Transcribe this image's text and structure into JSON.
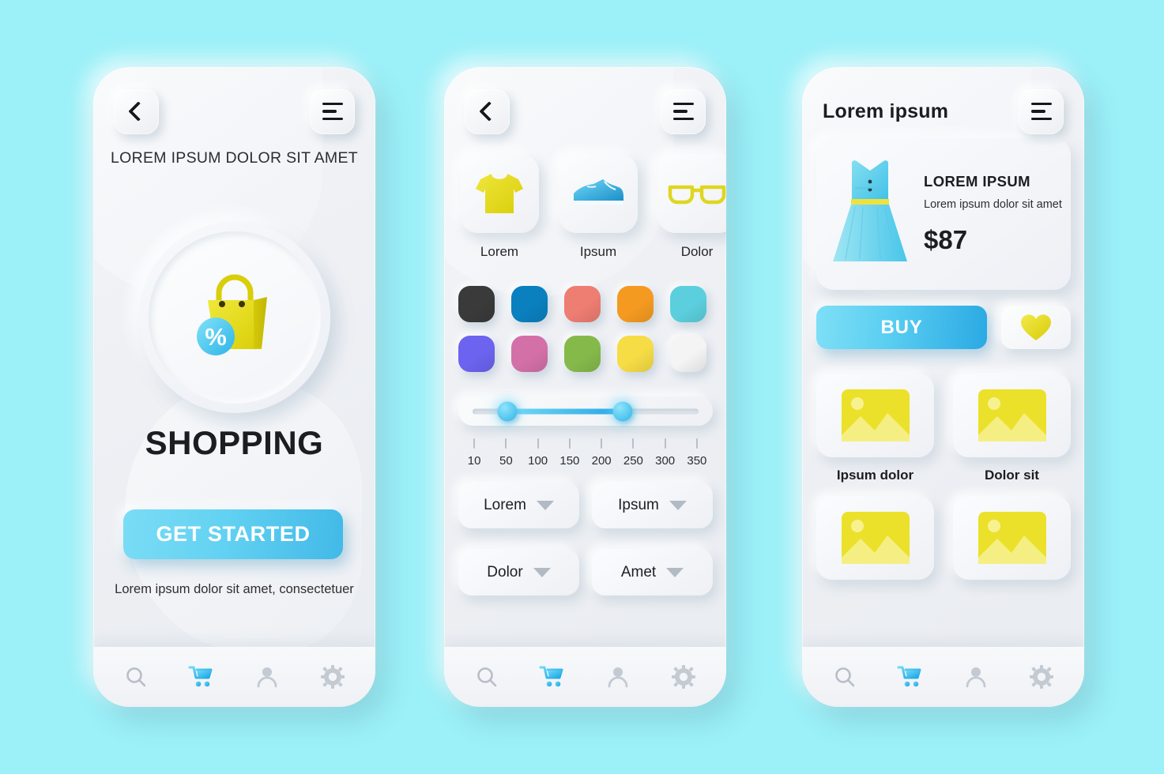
{
  "background_color": "#9CF0F8",
  "accent_blue": "#42B9E8",
  "accent_yellow": "#E8DE1E",
  "screen1": {
    "back_icon": "chevron-left-icon",
    "menu_icon": "hamburger-menu-icon",
    "subtitle": "LOREM IPSUM DOLOR SIT AMET",
    "hero_icon": "shopping-bag-discount-icon",
    "title": "SHOPPING",
    "cta_label": "GET STARTED",
    "footer_text": "Lorem ipsum dolor sit amet, consectetuer",
    "nav": [
      {
        "name": "search-icon",
        "active": false
      },
      {
        "name": "cart-icon",
        "active": true
      },
      {
        "name": "user-icon",
        "active": false
      },
      {
        "name": "settings-gear-icon",
        "active": false
      }
    ]
  },
  "screen2": {
    "back_icon": "chevron-left-icon",
    "menu_icon": "hamburger-menu-icon",
    "categories": [
      {
        "label": "Lorem",
        "icon": "tshirt-icon"
      },
      {
        "label": "Ipsum",
        "icon": "sneaker-icon"
      },
      {
        "label": "Dolor",
        "icon": "glasses-icon"
      }
    ],
    "swatches": [
      {
        "name": "swatch-black",
        "color": "#3A3A3A"
      },
      {
        "name": "swatch-blue",
        "color": "#0A80BF"
      },
      {
        "name": "swatch-salmon",
        "color": "#EE7D72"
      },
      {
        "name": "swatch-orange",
        "color": "#F59A21"
      },
      {
        "name": "swatch-cyan",
        "color": "#5CCFDE"
      },
      {
        "name": "swatch-purple",
        "color": "#6C63F0"
      },
      {
        "name": "swatch-pink",
        "color": "#D470A8"
      },
      {
        "name": "swatch-green",
        "color": "#85BA4B"
      },
      {
        "name": "swatch-yellow",
        "color": "#F6DC45"
      },
      {
        "name": "swatch-white",
        "color": "#F4F4F4"
      }
    ],
    "range_slider": {
      "lower_value": 75,
      "upper_value": 230,
      "min": 10,
      "max": 350,
      "ticks": [
        "10",
        "50",
        "100",
        "150",
        "200",
        "250",
        "300",
        "350"
      ]
    },
    "dropdowns": [
      {
        "label": "Lorem"
      },
      {
        "label": "Ipsum"
      },
      {
        "label": "Dolor"
      },
      {
        "label": "Amet"
      }
    ],
    "nav": [
      {
        "name": "search-icon",
        "active": false
      },
      {
        "name": "cart-icon",
        "active": true
      },
      {
        "name": "user-icon",
        "active": false
      },
      {
        "name": "settings-gear-icon",
        "active": false
      }
    ]
  },
  "screen3": {
    "header_title": "Lorem ipsum",
    "menu_icon": "hamburger-menu-icon",
    "product": {
      "image_icon": "dress-icon",
      "name": "LOREM IPSUM",
      "description": "Lorem ipsum dolor sit amet",
      "price": "$87"
    },
    "buy_label": "BUY",
    "favorite_icon": "heart-icon",
    "thumbnails": [
      {
        "label": "Ipsum dolor",
        "icon": "image-placeholder-icon"
      },
      {
        "label": "Dolor sit",
        "icon": "image-placeholder-icon"
      },
      {
        "label": "",
        "icon": "image-placeholder-icon"
      },
      {
        "label": "",
        "icon": "image-placeholder-icon"
      }
    ],
    "nav": [
      {
        "name": "search-icon",
        "active": false
      },
      {
        "name": "cart-icon",
        "active": true
      },
      {
        "name": "user-icon",
        "active": false
      },
      {
        "name": "settings-gear-icon",
        "active": false
      }
    ]
  }
}
